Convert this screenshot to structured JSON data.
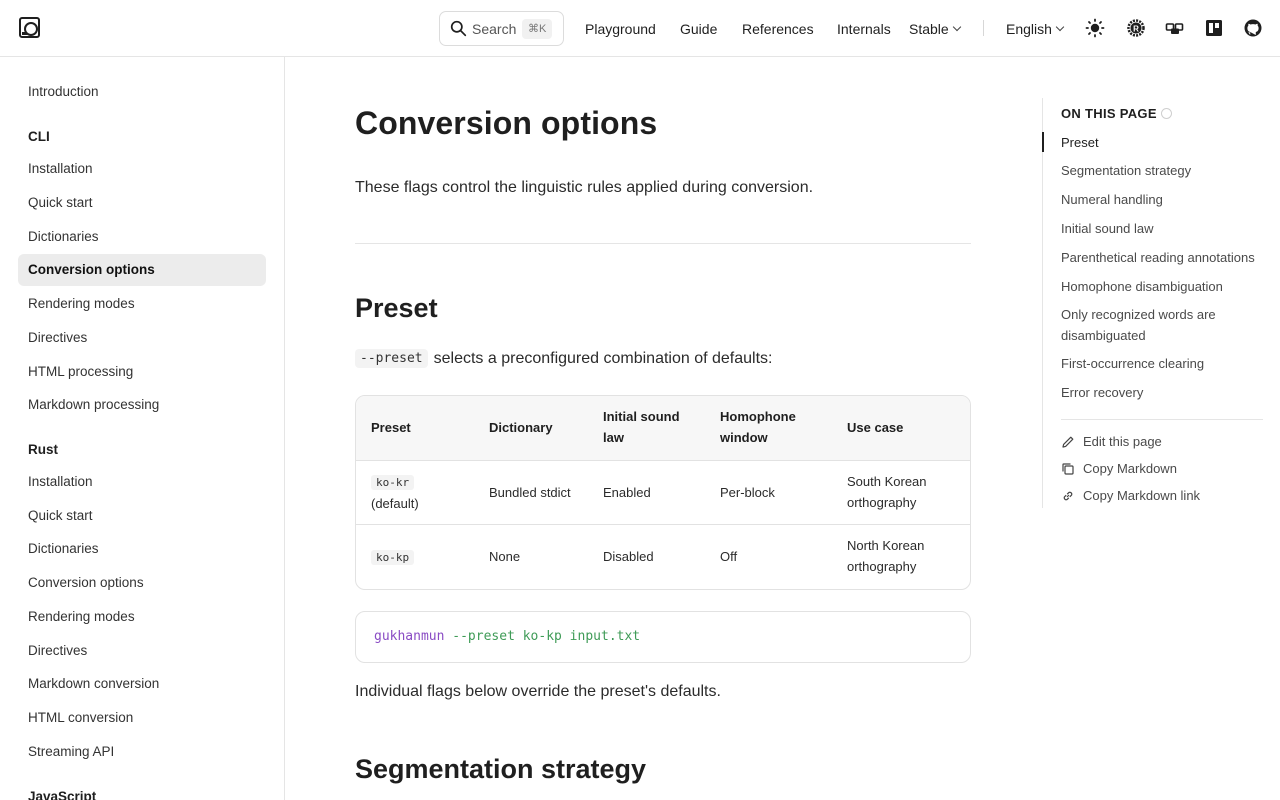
{
  "header": {
    "search_label": "Search",
    "search_shortcut": "⌘K",
    "nav": [
      "Playground",
      "Guide",
      "References",
      "Internals"
    ],
    "version": "Stable",
    "language": "English",
    "icons": [
      "logo-icon",
      "search-icon",
      "theme-sun-icon",
      "rust-icon",
      "crates-icon",
      "docs-icon",
      "github-icon"
    ]
  },
  "sidebar": {
    "intro": "Introduction",
    "cli_heading": "CLI",
    "cli_items": [
      "Installation",
      "Quick start",
      "Dictionaries",
      "Conversion options",
      "Rendering modes",
      "Directives",
      "HTML processing",
      "Markdown processing"
    ],
    "rust_heading": "Rust",
    "rust_items": [
      "Installation",
      "Quick start",
      "Dictionaries",
      "Conversion options",
      "Rendering modes",
      "Directives",
      "Markdown conversion",
      "HTML conversion",
      "Streaming API"
    ],
    "js_heading": "JavaScript",
    "active": "Conversion options"
  },
  "main": {
    "title": "Conversion options",
    "intro": "These flags control the linguistic rules applied during conversion.",
    "preset_heading": "Preset",
    "preset_code": "--preset",
    "preset_text": "selects a preconfigured combination of defaults:",
    "table": {
      "headers": [
        "Preset",
        "Dictionary",
        "Initial sound law",
        "Homophone window",
        "Use case"
      ],
      "rows": [
        {
          "code": "ko-kr",
          "note": "(default)",
          "dictionary": "Bundled stdict",
          "initial": "Enabled",
          "window": "Per-block",
          "use_case": "South Korean orthography"
        },
        {
          "code": "ko-kp",
          "note": "",
          "dictionary": "None",
          "initial": "Disabled",
          "window": "Off",
          "use_case": "North Korean orthography"
        }
      ]
    },
    "code": {
      "cmd": "gukhanmun",
      "args": "--preset ko-kp input.txt"
    },
    "override_text": "Individual flags below override the preset's defaults.",
    "segmentation_heading": "Segmentation strategy"
  },
  "toc": {
    "heading": "ON THIS PAGE",
    "items": [
      "Preset",
      "Segmentation strategy",
      "Numeral handling",
      "Initial sound law",
      "Parenthetical reading annotations",
      "Homophone disambiguation",
      "Only recognized words are disambiguated",
      "First-occurrence clearing",
      "Error recovery"
    ],
    "actions": [
      "Edit this page",
      "Copy Markdown",
      "Copy Markdown link"
    ]
  }
}
